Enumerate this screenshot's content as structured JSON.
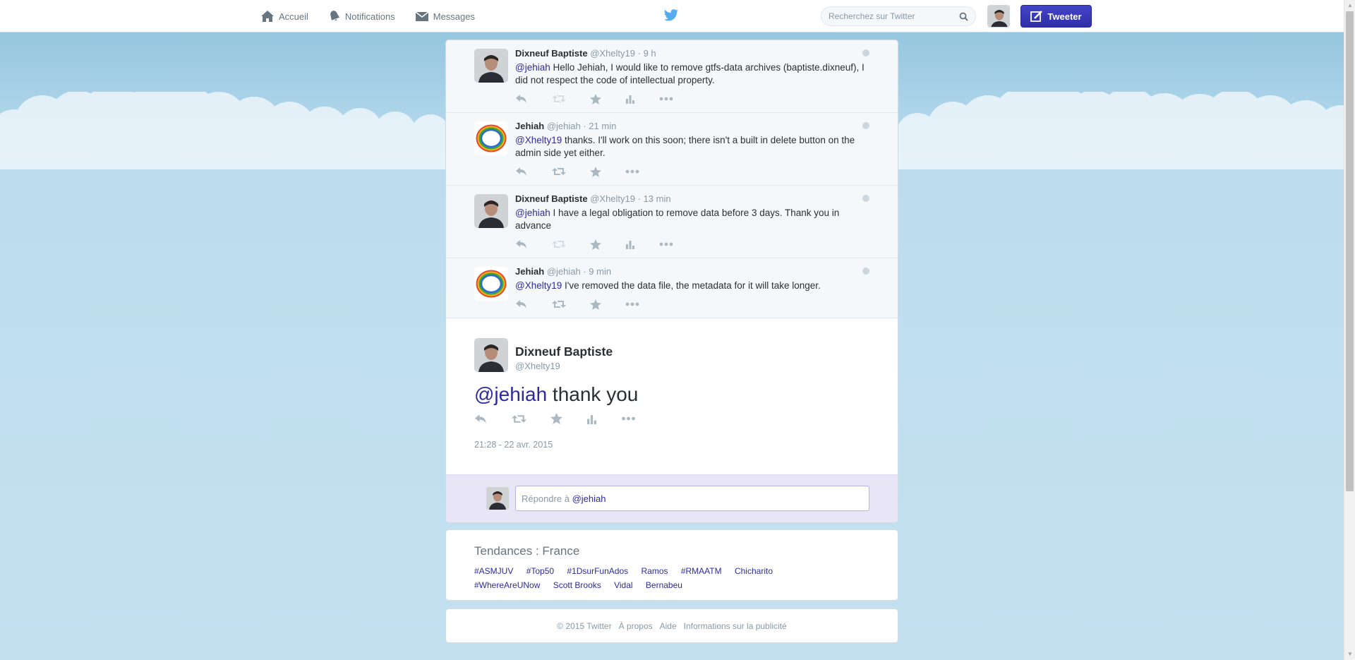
{
  "nav": {
    "home": "Accueil",
    "notifications": "Notifications",
    "messages": "Messages"
  },
  "search": {
    "placeholder": "Recherchez sur Twitter"
  },
  "tweet_button": "Tweeter",
  "conversation": [
    {
      "name": "Dixneuf Baptiste",
      "handle": "@Xhelty19",
      "time": "9 h",
      "mention": "@jehiah",
      "text": " Hello Jehiah, I would like to remove gtfs-data archives (baptiste.dixneuf), I did not respect the code of intellectual property.",
      "avatar": "person"
    },
    {
      "name": "Jehiah",
      "handle": "@jehiah",
      "time": "21 min",
      "mention": "@Xhelty19",
      "text": " thanks. I'll work on this soon; there isn't a built in delete button on the admin side yet either.",
      "avatar": "ring"
    },
    {
      "name": "Dixneuf Baptiste",
      "handle": "@Xhelty19",
      "time": "13 min",
      "mention": "@jehiah",
      "text": " I have a legal obligation to remove data before 3 days. Thank you in advance",
      "avatar": "person"
    },
    {
      "name": "Jehiah",
      "handle": "@jehiah",
      "time": "9 min",
      "mention": "@Xhelty19",
      "text": " I've removed the data file, the metadata for it will take longer.",
      "avatar": "ring"
    }
  ],
  "main_tweet": {
    "name": "Dixneuf Baptiste",
    "handle": "@Xhelty19",
    "mention": "@jehiah",
    "text": " thank you",
    "date": "21:28 - 22 avr. 2015"
  },
  "reply": {
    "prefix": "Répondre à ",
    "mention": "@jehiah"
  },
  "trends": {
    "title": "Tendances : France",
    "items": [
      "#ASMJUV",
      "#Top50",
      "#1DsurFunAdos",
      "Ramos",
      "#RMAATM",
      "Chicharito",
      "#WhereAreUNow",
      "Scott Brooks",
      "Vidal",
      "Bernabeu"
    ]
  },
  "footer": {
    "copyright": "© 2015 Twitter",
    "about": "À propos",
    "help": "Aide",
    "ads": "Informations sur la publicité"
  },
  "colors": {
    "accent": "#2b2b9e",
    "tweet_button": "#3b3bbb",
    "muted": "#8899a6"
  }
}
